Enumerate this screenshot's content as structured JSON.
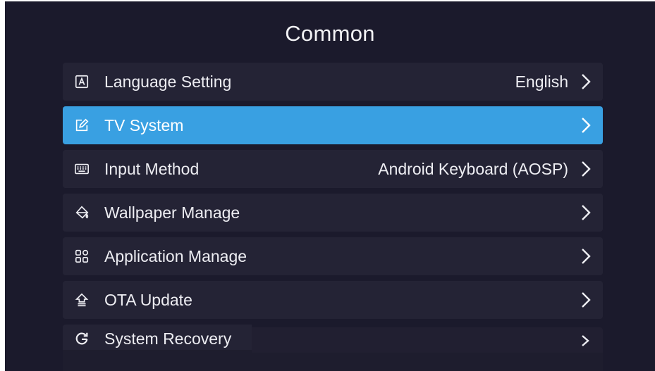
{
  "header": {
    "title": "Common"
  },
  "items": [
    {
      "label": "Language Setting",
      "value": "English",
      "icon": "language-icon",
      "selected": false
    },
    {
      "label": "TV System",
      "value": "",
      "icon": "edit-icon",
      "selected": true
    },
    {
      "label": "Input Method",
      "value": "Android Keyboard (AOSP)",
      "icon": "keyboard-icon",
      "selected": false
    },
    {
      "label": "Wallpaper Manage",
      "value": "",
      "icon": "paint-bucket-icon",
      "selected": false
    },
    {
      "label": "Application Manage",
      "value": "",
      "icon": "apps-grid-icon",
      "selected": false
    },
    {
      "label": "OTA Update",
      "value": "",
      "icon": "upload-icon",
      "selected": false
    },
    {
      "label": "System Recovery",
      "value": "",
      "icon": "refresh-icon",
      "selected": false
    }
  ],
  "colors": {
    "background": "#1b1a2c",
    "row": "#242335",
    "selected": "#39a0e2",
    "text": "#ededf2"
  }
}
